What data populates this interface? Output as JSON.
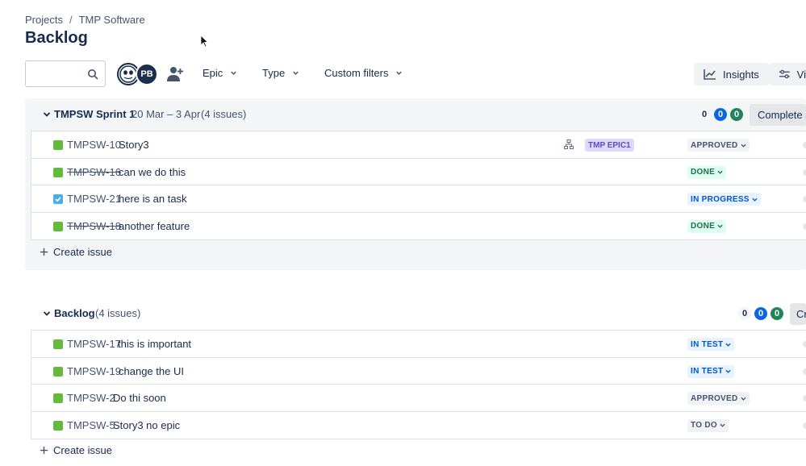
{
  "breadcrumb": {
    "projects": "Projects",
    "separator": "/",
    "software": "TMP Software"
  },
  "page_title": "Backlog",
  "toolbar": {
    "search_placeholder": "",
    "avatar_initials": "PB",
    "filters": {
      "epic": "Epic",
      "type": "Type",
      "custom": "Custom filters"
    },
    "insights_label": "Insights",
    "view_label": "Vi"
  },
  "sprint": {
    "name": "TMPSW Sprint 1",
    "dates": "20 Mar – 3 Apr",
    "count": "(4 issues)",
    "counts": {
      "todo": "0",
      "inprogress": "0",
      "done": "0"
    },
    "complete_label": "Complete s",
    "issues": [
      {
        "key": "TMPSW-10",
        "summary": "Story3",
        "type": "story",
        "epic": "TMP EPIC1",
        "status": "APPROVED",
        "done": false
      },
      {
        "key": "TMPSW-16",
        "summary": "can we do this",
        "type": "story",
        "epic": "",
        "status": "DONE",
        "done": true
      },
      {
        "key": "TMPSW-21",
        "summary": "here is an task",
        "type": "task",
        "epic": "",
        "status": "IN PROGRESS",
        "done": false
      },
      {
        "key": "TMPSW-18",
        "summary": "another feature",
        "type": "story",
        "epic": "",
        "status": "DONE",
        "done": true
      }
    ],
    "create_label": "Create issue"
  },
  "backlog": {
    "name": "Backlog",
    "count": "(4 issues)",
    "counts": {
      "todo": "0",
      "inprogress": "0",
      "done": "0"
    },
    "create_sprint_label": "Cr",
    "issues": [
      {
        "key": "TMPSW-17",
        "summary": "this is important",
        "type": "story",
        "status": "IN TEST"
      },
      {
        "key": "TMPSW-19",
        "summary": "change the UI",
        "type": "story",
        "status": "IN TEST"
      },
      {
        "key": "TMPSW-2",
        "summary": "Do thi soon",
        "type": "story",
        "status": "APPROVED"
      },
      {
        "key": "TMPSW-5",
        "summary": "Story3 no epic",
        "type": "story",
        "status": "TO DO"
      }
    ],
    "create_label": "Create issue"
  },
  "colors": {
    "story": "#63ba3c",
    "task": "#4bade8",
    "blue_badge": "#0c66e4",
    "green_badge": "#1f845a"
  }
}
